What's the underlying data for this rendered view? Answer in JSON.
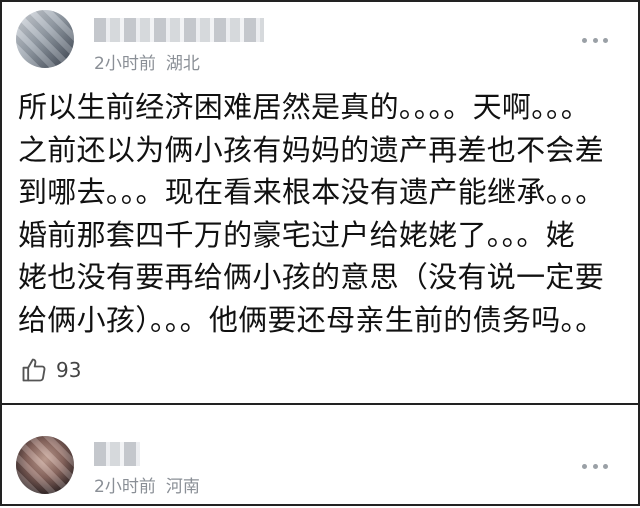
{
  "comments": [
    {
      "time": "2小时前",
      "location": "湖北",
      "lines": [
        "所以生前经济困难居然是真的。。。。天啊。。。",
        "之前还以为俩小孩有妈妈的遗产再差也不会差",
        "到哪去。。。现在看来根本没有遗产能继承。。。",
        "婚前那套四千万的豪宅过户给姥姥了。。。姥",
        "姥也没有要再给俩小孩的意思（没有说一定要",
        "给俩小孩）。。。他俩要还母亲生前的债务吗。。"
      ],
      "likes": "93",
      "like_icon": "thumbs-up-icon",
      "more_icon": "more-dots-icon"
    },
    {
      "time": "2小时前",
      "location": "河南",
      "more_icon": "more-dots-icon"
    }
  ],
  "colors": {
    "meta_text": "#8a8f96",
    "body_text": "#111111",
    "border": "#222222"
  }
}
